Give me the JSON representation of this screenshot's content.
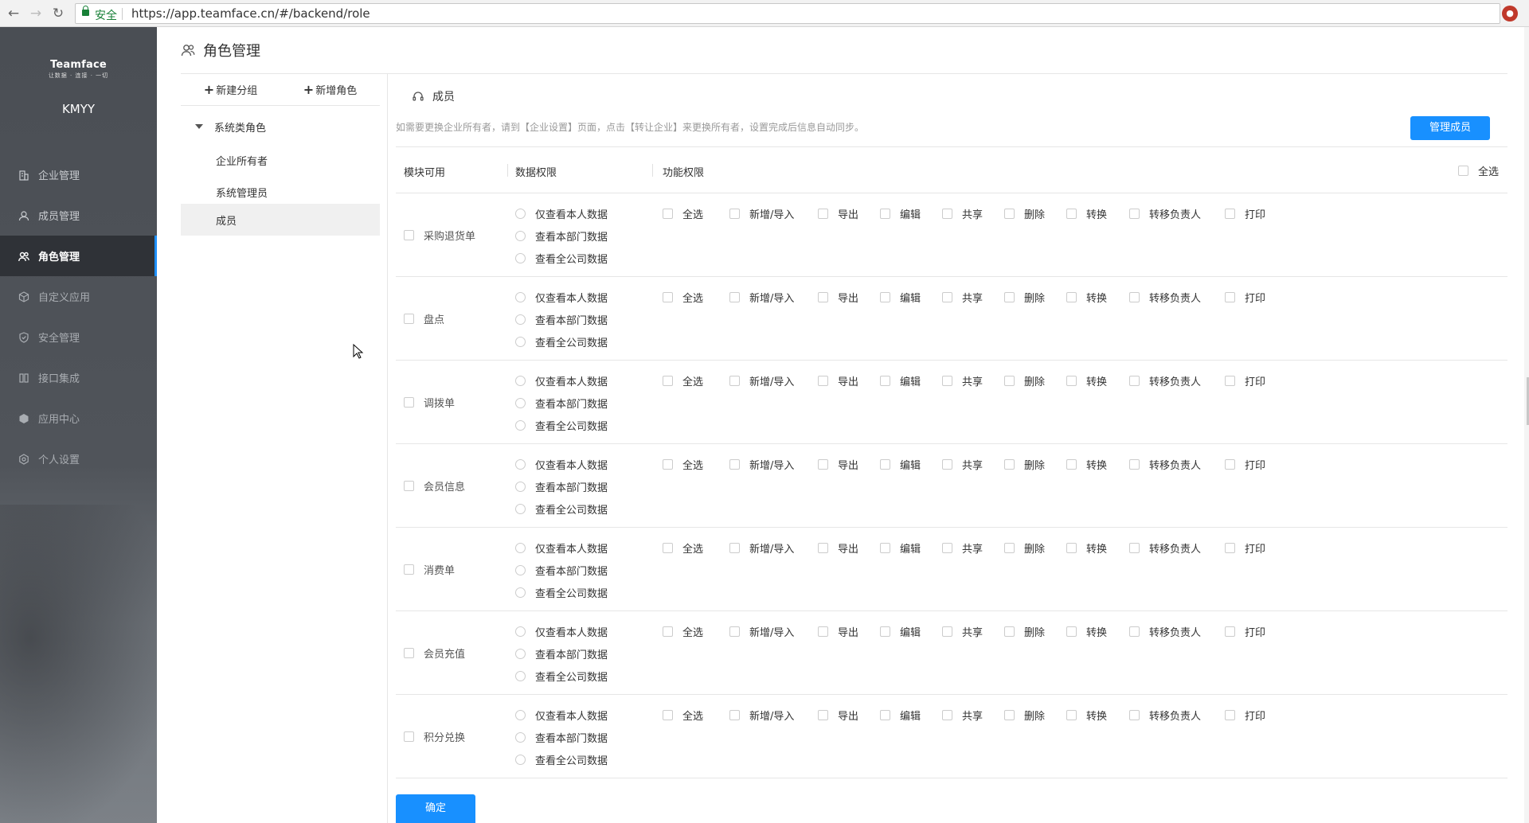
{
  "browser": {
    "secure_label": "安全",
    "url": "https://app.teamface.cn/#/backend/role"
  },
  "sidebar": {
    "brand": "Teamface",
    "brand_sub": "让数据 · 连接 · 一切",
    "company": "KMYY",
    "items": [
      {
        "label": "企业管理",
        "icon": "building-icon"
      },
      {
        "label": "成员管理",
        "icon": "user-icon"
      },
      {
        "label": "角色管理",
        "icon": "role-icon"
      },
      {
        "label": "自定义应用",
        "icon": "cube-icon"
      },
      {
        "label": "安全管理",
        "icon": "shield-icon"
      },
      {
        "label": "接口集成",
        "icon": "plug-icon"
      },
      {
        "label": "应用中心",
        "icon": "app-icon"
      },
      {
        "label": "个人设置",
        "icon": "gear-icon"
      }
    ],
    "active_index": 2
  },
  "header": {
    "title": "角色管理"
  },
  "tree": {
    "add_group": "新建分组",
    "add_role": "新增角色",
    "group": "系统类角色",
    "roles": [
      "企业所有者",
      "系统管理员",
      "成员"
    ],
    "selected": "成员"
  },
  "main": {
    "section_title": "成员",
    "notice": "如需要更换企业所有者，请到【企业设置】页面，点击【转让企业】来更换所有者，设置完成后信息自动同步。",
    "manage_button": "管理成员",
    "columns": {
      "module": "模块可用",
      "data": "数据权限",
      "function": "功能权限",
      "select_all": "全选"
    },
    "data_perm_options": [
      "仅查看本人数据",
      "查看本部门数据",
      "查看全公司数据"
    ],
    "func_perm_options": [
      "全选",
      "新增/导入",
      "导出",
      "编辑",
      "共享",
      "删除",
      "转换",
      "转移负责人",
      "打印"
    ],
    "modules": [
      "采购退货单",
      "盘点",
      "调拨单",
      "会员信息",
      "消费单",
      "会员充值",
      "积分兑换"
    ],
    "confirm_button": "确定"
  }
}
